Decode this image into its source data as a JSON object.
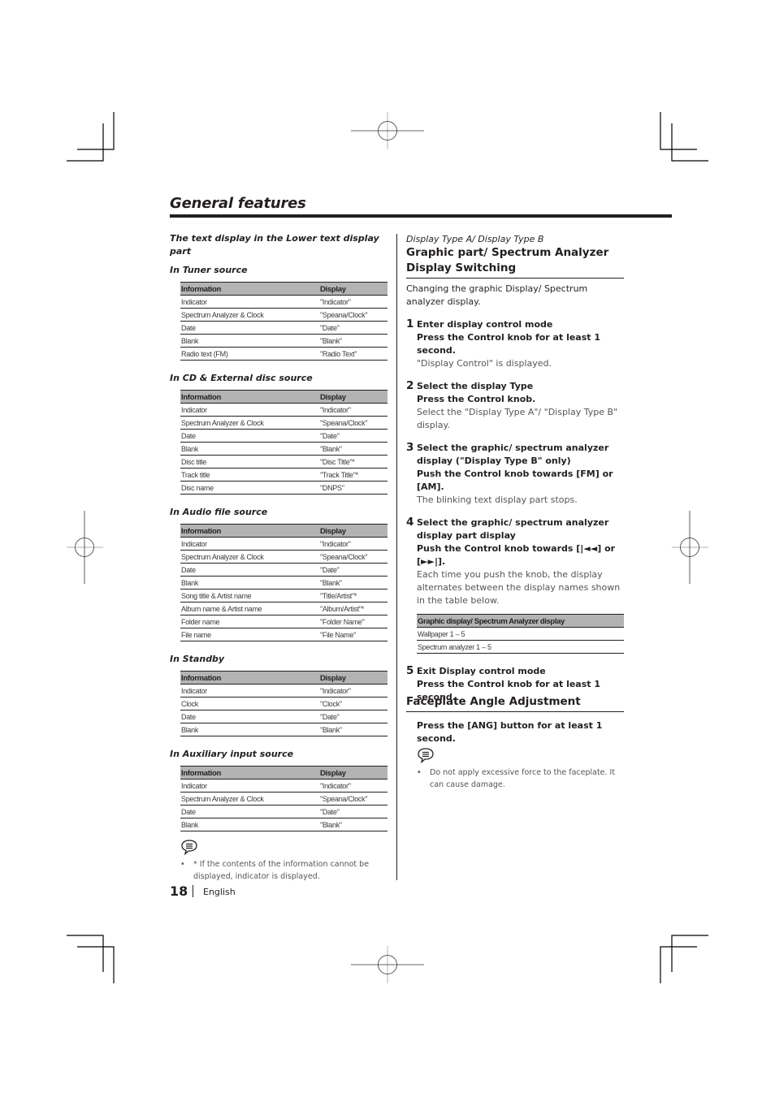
{
  "page": {
    "title": "General features",
    "page_number": "18",
    "language": "English"
  },
  "left": {
    "section_title": "The text display in the Lower text display part",
    "table_headers": {
      "information": "Information",
      "display": "Display"
    },
    "sources": [
      {
        "title": "In Tuner source",
        "rows": [
          {
            "information": "Indicator",
            "display": "\"Indicator\""
          },
          {
            "information": "Spectrum Analyzer & Clock",
            "display": "\"Speana/Clock\""
          },
          {
            "information": "Date",
            "display": "\"Date\""
          },
          {
            "information": "Blank",
            "display": "\"Blank\""
          },
          {
            "information": "Radio text (FM)",
            "display": "\"Radio Text\""
          }
        ]
      },
      {
        "title": "In CD & External disc source",
        "rows": [
          {
            "information": "Indicator",
            "display": "\"Indicator\""
          },
          {
            "information": "Spectrum Analyzer & Clock",
            "display": "\"Speana/Clock\""
          },
          {
            "information": "Date",
            "display": "\"Date\""
          },
          {
            "information": "Blank",
            "display": "\"Blank\""
          },
          {
            "information": "Disc title",
            "display": "\"Disc Title\"*"
          },
          {
            "information": "Track title",
            "display": "\"Track Title\"*"
          },
          {
            "information": "Disc name",
            "display": "\"DNPS\""
          }
        ]
      },
      {
        "title": "In Audio file source",
        "rows": [
          {
            "information": "Indicator",
            "display": "\"Indicator\""
          },
          {
            "information": "Spectrum Analyzer & Clock",
            "display": "\"Speana/Clock\""
          },
          {
            "information": "Date",
            "display": "\"Date\""
          },
          {
            "information": "Blank",
            "display": "\"Blank\""
          },
          {
            "information": "Song title & Artist name",
            "display": "\"Title/Artist\"*"
          },
          {
            "information": "Album name & Artist name",
            "display": "\"Album/Artist\"*"
          },
          {
            "information": "Folder name",
            "display": "\"Folder Name\""
          },
          {
            "information": "File name",
            "display": "\"File Name\""
          }
        ]
      },
      {
        "title": "In Standby",
        "rows": [
          {
            "information": "Indicator",
            "display": "\"Indicator\""
          },
          {
            "information": "Clock",
            "display": "\"Clock\""
          },
          {
            "information": "Date",
            "display": "\"Date\""
          },
          {
            "information": "Blank",
            "display": "\"Blank\""
          }
        ]
      },
      {
        "title": "In Auxiliary input source",
        "rows": [
          {
            "information": "Indicator",
            "display": "\"Indicator\""
          },
          {
            "information": "Spectrum Analyzer & Clock",
            "display": "\"Speana/Clock\""
          },
          {
            "information": "Date",
            "display": "\"Date\""
          },
          {
            "information": "Blank",
            "display": "\"Blank\""
          }
        ]
      }
    ],
    "note": {
      "icon": "note-speech-bubble-icon",
      "bullet": "•",
      "text": "* If the contents of the information cannot be displayed, indicator is displayed."
    }
  },
  "right": {
    "kicker": "Display Type A/ Display Type B",
    "heading": "Graphic part/ Spectrum Analyzer Display Switching",
    "lead": "Changing the graphic Display/ Spectrum analyzer display.",
    "steps": [
      {
        "num": "1",
        "head": "Enter display control mode",
        "action": "Press the Control knob for at least 1 second.",
        "desc": "\"Display Control\" is displayed."
      },
      {
        "num": "2",
        "head": "Select the display Type",
        "action": "Press the Control knob.",
        "desc": "Select the \"Display Type A\"/ \"Display Type B\" display."
      },
      {
        "num": "3",
        "head": "Select the graphic/ spectrum analyzer display (\"Display Type B\" only)",
        "action": "Push the Control knob towards [FM] or [AM].",
        "desc": "The blinking text display part stops."
      },
      {
        "num": "4",
        "head": "Select the graphic/ spectrum analyzer display part display",
        "action": "Push the Control knob towards [|◄◄] or [►►|].",
        "desc": "Each time you push the knob, the display alternates between the display names shown in the table below."
      },
      {
        "num": "5",
        "head": "Exit Display control mode",
        "action": "Press the Control knob for at least 1 second.",
        "desc": ""
      }
    ],
    "graphic_table": {
      "header": "Graphic display/ Spectrum Analyzer display",
      "rows": [
        "Wallpaper  1 – 5",
        "Spectrum analyzer 1 – 5"
      ]
    },
    "faceplate": {
      "heading": "Faceplate Angle Adjustment",
      "action": "Press the [ANG] button for at least 1 second.",
      "note_icon": "note-speech-bubble-icon",
      "note_bullet": "•",
      "note": "Do not apply excessive force to the faceplate. It can cause damage."
    }
  }
}
